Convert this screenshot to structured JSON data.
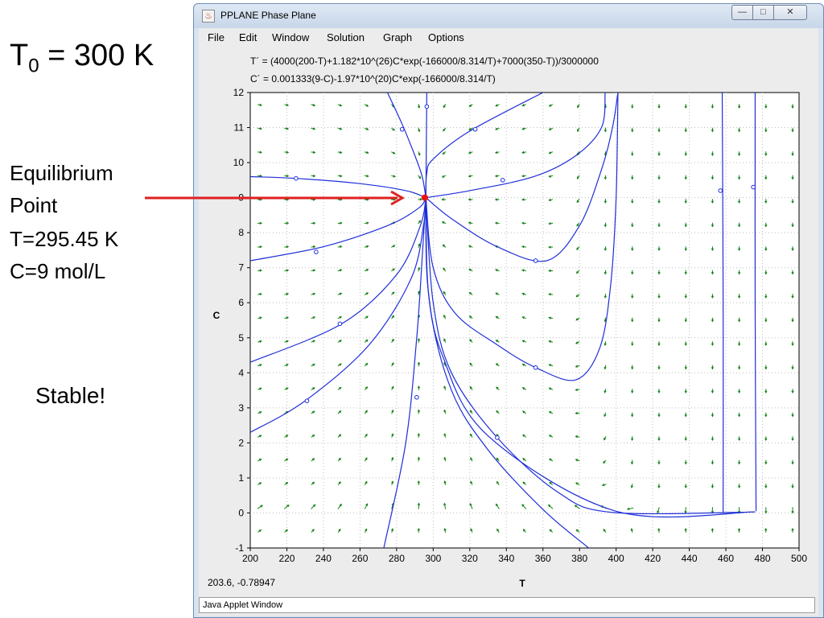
{
  "slide": {
    "t0_main": "T",
    "t0_sub": "0",
    "t0_rest": " = 300 K",
    "eq_line1": "Equilibrium",
    "eq_line2": "Point",
    "eq_line3": "T=295.45 K",
    "eq_line4": "C=9 mol/L",
    "stable": "Stable!",
    "arrow_color": "#e02020"
  },
  "window": {
    "title": "PPLANE Phase Plane",
    "menu": [
      "File",
      "Edit",
      "Window",
      "Solution",
      "Graph",
      "Options"
    ],
    "equation_t": "T´ = (4000(200-T)+1.182*10^(26)C*exp(-166000/8.314/T)+7000(350-T))/3000000",
    "equation_c": "C´ = 0.001333(9-C)-1.97*10^(20)C*exp(-166000/8.314/T)",
    "coord_readout": "203.6,  -0.78947",
    "status": "Java Applet Window"
  },
  "chart_data": {
    "type": "scatter",
    "subtype": "phase-plane",
    "xlabel": "T",
    "ylabel": "C",
    "xlim": [
      200,
      500
    ],
    "ylim": [
      -1,
      12
    ],
    "xticks": [
      200,
      220,
      240,
      260,
      280,
      300,
      320,
      340,
      360,
      380,
      400,
      420,
      440,
      460,
      480,
      500
    ],
    "yticks": [
      -1,
      0,
      1,
      2,
      3,
      4,
      5,
      6,
      7,
      8,
      9,
      10,
      11,
      12
    ],
    "grid": true,
    "equilibrium": {
      "T": 295.45,
      "C": 9
    },
    "colors": {
      "trajectory": "#1e2ed8",
      "field": "#108010",
      "equilibrium": "#ee1111"
    },
    "trajectories": [
      [
        [
          296.5,
          12
        ],
        [
          296,
          9
        ]
      ],
      [
        [
          275,
          12
        ],
        [
          283,
          11.1
        ],
        [
          290,
          10.2
        ],
        [
          294,
          9.6
        ],
        [
          296,
          9
        ]
      ],
      [
        [
          360,
          12
        ],
        [
          320,
          10.9
        ],
        [
          300,
          10.1
        ],
        [
          296.5,
          9.7
        ],
        [
          296,
          9
        ]
      ],
      [
        [
          200,
          9.6
        ],
        [
          225,
          9.55
        ],
        [
          260,
          9.4
        ],
        [
          285,
          9.2
        ],
        [
          296,
          9
        ]
      ],
      [
        [
          394,
          12
        ],
        [
          392,
          11
        ],
        [
          378,
          10.2
        ],
        [
          355,
          9.6
        ],
        [
          320,
          9.2
        ],
        [
          296,
          9
        ]
      ],
      [
        [
          200,
          7.2
        ],
        [
          240,
          7.6
        ],
        [
          275,
          8.2
        ],
        [
          292,
          8.7
        ],
        [
          296,
          9
        ]
      ],
      [
        [
          401,
          12
        ],
        [
          398,
          11
        ],
        [
          392,
          9.8
        ],
        [
          380,
          8.2
        ],
        [
          362,
          7.2
        ],
        [
          335,
          7.6
        ],
        [
          310,
          8.4
        ],
        [
          296,
          9
        ]
      ],
      [
        [
          200,
          4.3
        ],
        [
          250,
          5.4
        ],
        [
          280,
          6.8
        ],
        [
          293,
          8.2
        ],
        [
          296,
          9
        ]
      ],
      [
        [
          200,
          2.3
        ],
        [
          230,
          3.2
        ],
        [
          265,
          4.8
        ],
        [
          288,
          6.7
        ],
        [
          295,
          8.3
        ],
        [
          296,
          9
        ]
      ],
      [
        [
          273,
          -1
        ],
        [
          285,
          2
        ],
        [
          291,
          5
        ],
        [
          294,
          7.3
        ],
        [
          296,
          9
        ]
      ],
      [
        [
          296,
          9
        ],
        [
          300,
          7
        ],
        [
          312,
          5.7
        ],
        [
          335,
          4.8
        ],
        [
          356,
          4.15
        ],
        [
          378,
          3.8
        ],
        [
          391,
          4.7
        ],
        [
          397,
          6.5
        ],
        [
          400,
          9
        ],
        [
          401,
          12
        ]
      ],
      [
        [
          296,
          9
        ],
        [
          300,
          6
        ],
        [
          310,
          4
        ],
        [
          335,
          2.15
        ],
        [
          368,
          0.6
        ],
        [
          397,
          0.02
        ],
        [
          470,
          0.02
        ]
      ],
      [
        [
          296,
          9
        ],
        [
          298,
          6
        ],
        [
          310,
          3.5
        ],
        [
          330,
          1.8
        ],
        [
          360,
          0.1
        ],
        [
          385,
          -1
        ]
      ],
      [
        [
          296,
          9
        ],
        [
          297,
          6.5
        ],
        [
          305,
          4.5
        ],
        [
          330,
          2.2
        ],
        [
          400,
          0.05
        ],
        [
          476,
          0.03
        ]
      ],
      [
        [
          458,
          12
        ],
        [
          458.5,
          6
        ],
        [
          458.5,
          0
        ]
      ],
      [
        [
          476,
          12
        ],
        [
          476,
          6
        ],
        [
          476.5,
          0.05
        ]
      ]
    ],
    "markers": [
      [
        296.5,
        11.6
      ],
      [
        283,
        10.95
      ],
      [
        323,
        10.95
      ],
      [
        225,
        9.55
      ],
      [
        338,
        9.5
      ],
      [
        236,
        7.45
      ],
      [
        356,
        7.2
      ],
      [
        249,
        5.4
      ],
      [
        356,
        4.15
      ],
      [
        231,
        3.2
      ],
      [
        291,
        3.3
      ],
      [
        335,
        2.15
      ],
      [
        457,
        9.2
      ],
      [
        475,
        9.3
      ]
    ]
  }
}
